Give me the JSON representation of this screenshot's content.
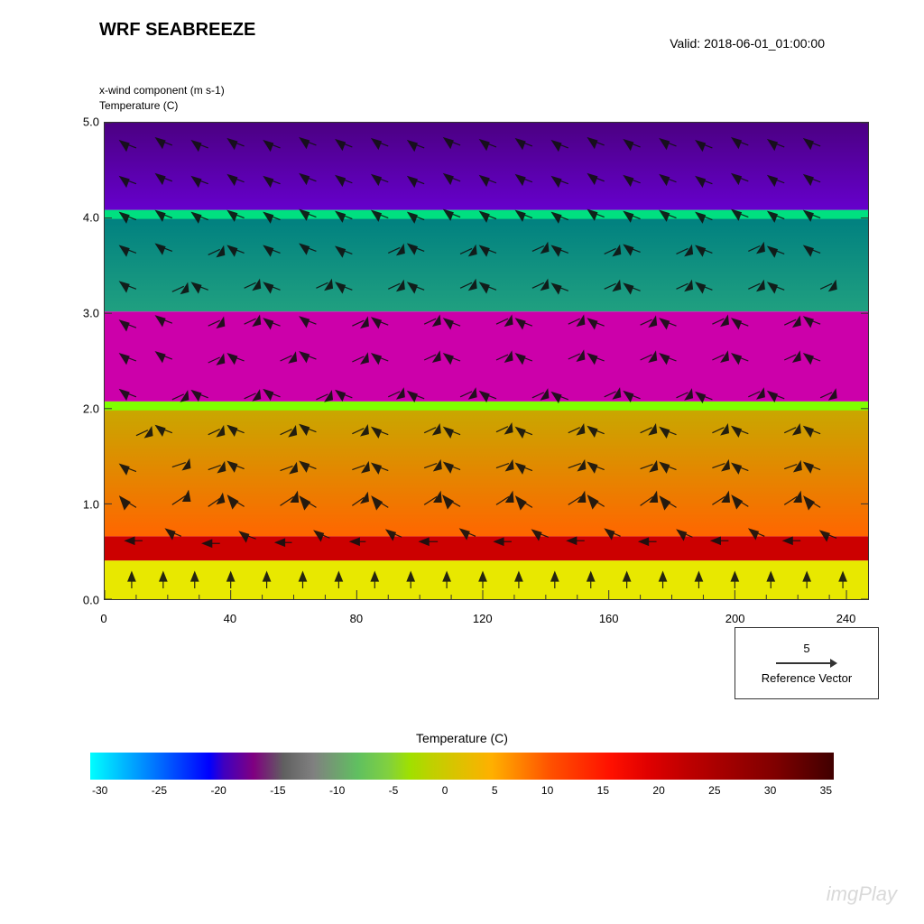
{
  "title": "WRF SEABREEZE",
  "valid_time": "Valid: 2018-06-01_01:00:00",
  "y_label_line1": "x-wind component   (m s-1)",
  "y_label_line2": "Temperature   (C)",
  "x_axis": {
    "ticks": [
      {
        "label": "0",
        "pct": 0
      },
      {
        "label": "40",
        "pct": 16.5
      },
      {
        "label": "80",
        "pct": 33
      },
      {
        "label": "120",
        "pct": 49.5
      },
      {
        "label": "160",
        "pct": 66
      },
      {
        "label": "200",
        "pct": 82.5
      },
      {
        "label": "240",
        "pct": 97
      }
    ]
  },
  "y_axis": {
    "ticks": [
      {
        "label": "0.0",
        "pct": 0
      },
      {
        "label": "1.0",
        "pct": 20
      },
      {
        "label": "2.0",
        "pct": 40
      },
      {
        "label": "3.0",
        "pct": 60
      },
      {
        "label": "4.0",
        "pct": 80
      },
      {
        "label": "5.0",
        "pct": 100
      }
    ]
  },
  "reference_vector": {
    "value": "5",
    "label": "Reference Vector"
  },
  "colorbar": {
    "title": "Temperature  (C)",
    "ticks": [
      "-30",
      "-25",
      "-20",
      "-15",
      "-10",
      "-5",
      "0",
      "5",
      "10",
      "15",
      "20",
      "25",
      "30",
      "35"
    ]
  },
  "watermark": "imgPlay"
}
